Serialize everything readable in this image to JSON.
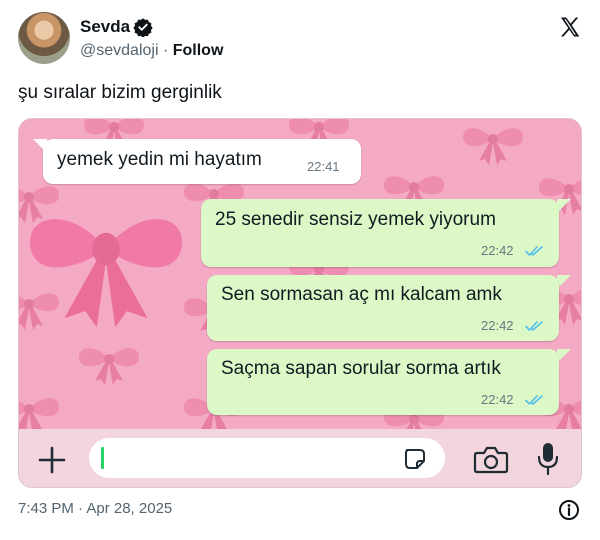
{
  "author": {
    "display_name": "Sevda",
    "handle": "@sevdaloji",
    "separator": "·",
    "follow_label": "Follow",
    "verified_icon": "verified-badge-icon",
    "logo_icon": "x-logo-icon"
  },
  "tweet": {
    "text": "şu sıralar bizim gerginlik",
    "timestamp": "7:43 PM · Apr 28, 2025"
  },
  "chat": {
    "messages": [
      {
        "direction": "incoming",
        "text": "yemek yedin mi hayatım",
        "time": "22:41"
      },
      {
        "direction": "outgoing",
        "text": "25 senedir sensiz yemek yiyorum",
        "time": "22:42",
        "status": "read"
      },
      {
        "direction": "outgoing",
        "text": "Sen sormasan aç mı kalcam amk",
        "time": "22:42",
        "status": "read"
      },
      {
        "direction": "outgoing",
        "text": "Saçma sapan sorular sorma artık",
        "time": "22:42",
        "status": "read"
      }
    ],
    "input_placeholder": "",
    "icons": [
      "plus-icon",
      "sticker-icon",
      "camera-icon",
      "microphone-icon"
    ]
  },
  "colors": {
    "wallpaper": "#f4a9c4",
    "outgoing_bubble": "#dcf8c6",
    "incoming_bubble": "#ffffff",
    "read_ticks": "#53bdeb",
    "verified": "#0f1419"
  }
}
